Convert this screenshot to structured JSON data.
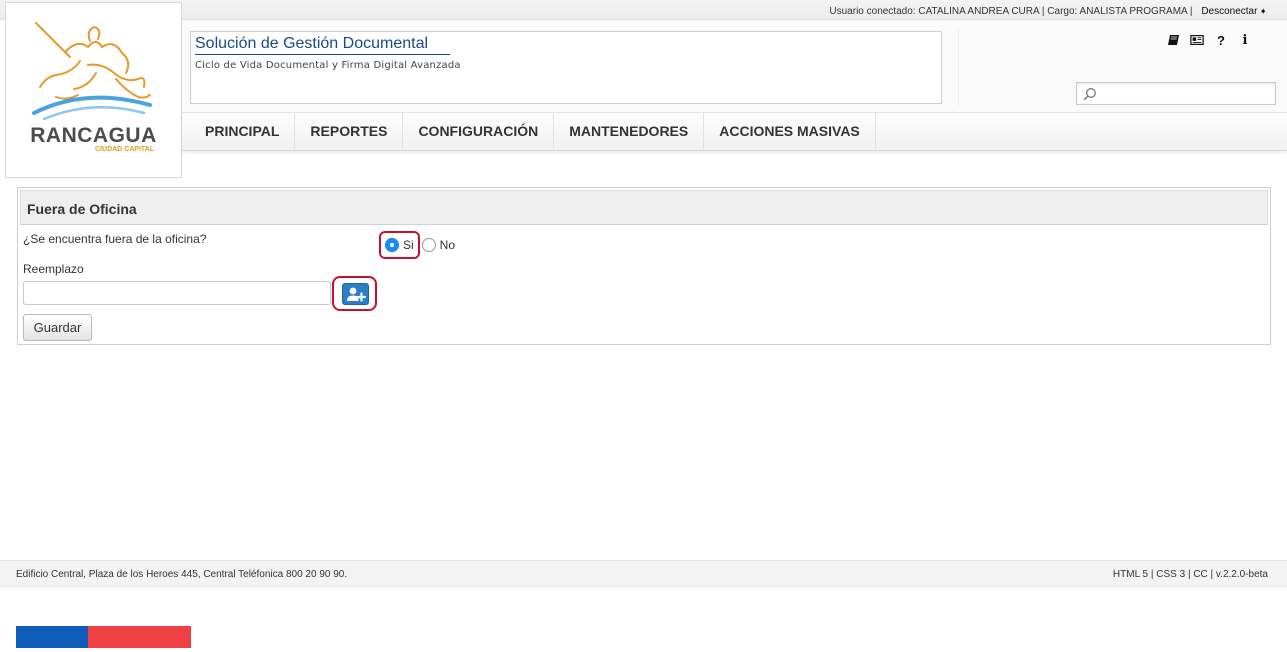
{
  "header": {
    "user_prefix": "Usuario conectado:",
    "user_name": "CATALINA ANDREA CURA",
    "role_prefix": "| Cargo:",
    "role": "ANALISTA PROGRAMA |",
    "logout_label": "Desconectar"
  },
  "logo": {
    "name": "RANCAGUA",
    "subtitle": "CIUDAD CAPITAL",
    "accent_color": "#e59a2c"
  },
  "app": {
    "title": "Solución de Gestión Documental",
    "subtitle": "Ciclo de Vida Documental y Firma Digital Avanzada"
  },
  "toolbar": {
    "icons": [
      "book-icon",
      "newspaper-icon",
      "question-icon",
      "info-icon"
    ],
    "question_glyph": "?",
    "info_glyph": "i"
  },
  "search": {
    "placeholder": ""
  },
  "nav": {
    "items": [
      {
        "label": "PRINCIPAL"
      },
      {
        "label": "REPORTES"
      },
      {
        "label": "CONFIGURACIÓN"
      },
      {
        "label": "MANTENEDORES"
      },
      {
        "label": "ACCIONES MASIVAS"
      }
    ]
  },
  "panel": {
    "title": "Fuera de Oficina",
    "question": "¿Se encuentra fuera de la oficina?",
    "option_yes": "Si",
    "option_no": "No",
    "selected": "Si",
    "replacement_label": "Reemplazo",
    "replacement_value": "",
    "save_label": "Guardar"
  },
  "footer": {
    "address": "Edificio Central, Plaza de los Heroes 445, Central Teléfonica 800 20 90 90.",
    "tech": "HTML 5 | CSS 3 | CC | v.2.2.0-beta"
  },
  "colors": {
    "title_blue": "#1a4a8a",
    "highlight_red": "#c8102e",
    "button_blue": "#2a7fc8",
    "flag_blue": "#0f5db8",
    "flag_red": "#ef4045"
  }
}
